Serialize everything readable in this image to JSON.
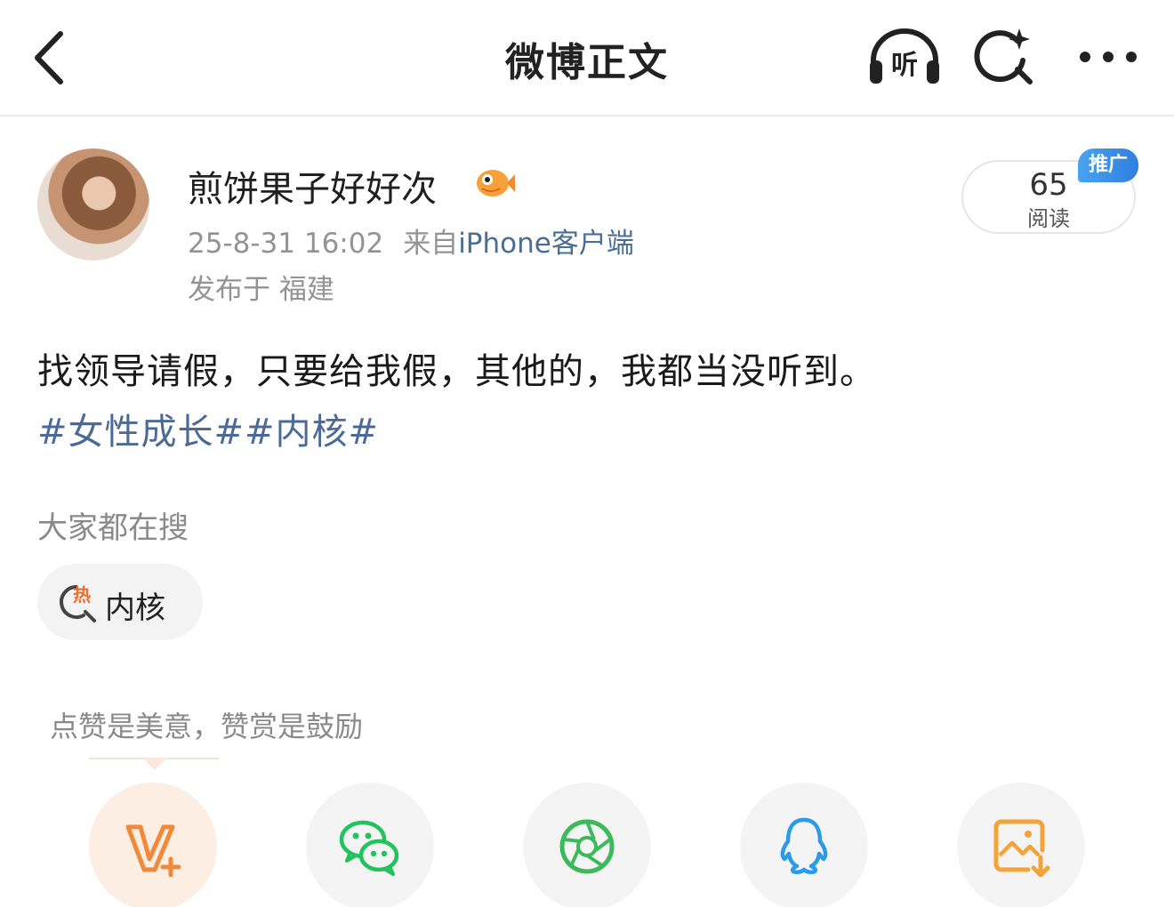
{
  "header": {
    "title": "微博正文",
    "listen_label": "听"
  },
  "author": {
    "name": "煎饼果子好好次",
    "time": "25-8-31 16:02",
    "source_prefix": "来自",
    "source": "iPhone客户端",
    "location": "发布于 福建",
    "read_count": "65",
    "read_label": "阅读",
    "promo_label": "推广"
  },
  "post": {
    "text": "找领导请假，只要给我假，其他的，我都当没听到。",
    "topics": [
      "#女性成长#",
      "#内核#"
    ]
  },
  "search": {
    "label": "大家都在搜",
    "chip_badge": "热",
    "chip": "内核"
  },
  "reward": {
    "hint": "点赞是美意，赞赏是鼓励"
  },
  "share": {
    "icons": [
      "vplus-icon",
      "wechat-icon",
      "moments-icon",
      "qq-icon",
      "save-image-icon"
    ]
  },
  "colors": {
    "link": "#4b6a98",
    "source": "#4a6d96",
    "muted": "#939393",
    "promo": "#2f7fe0",
    "vplus": "#f08a3a",
    "wechat": "#22c35e",
    "moments": "#3cb95a",
    "qq": "#2b9be8",
    "save": "#f2a33a"
  }
}
